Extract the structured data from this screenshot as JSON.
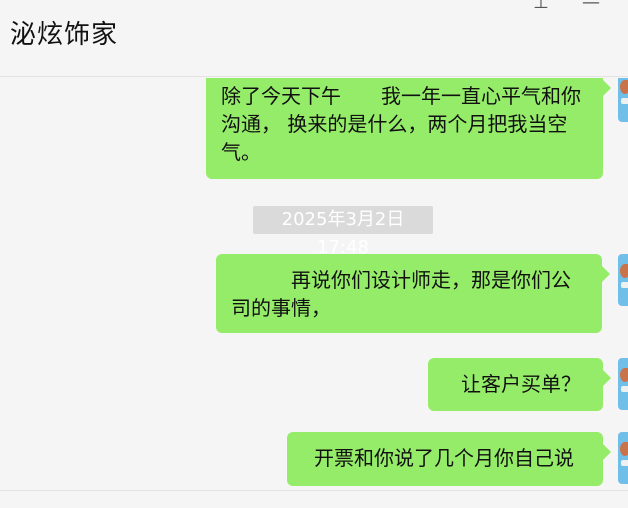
{
  "header": {
    "title": "泌炫饰家",
    "pin_glyph": "⊥",
    "minimize_glyph": "—"
  },
  "messages": [
    {
      "side": "right",
      "text": "除了今天下午　　我一年一直心平气和你沟通， 换来的是什么，两个月把我当空气。"
    },
    {
      "side": "right",
      "text": "再说你们设计师走，那是你们公司的事情，"
    },
    {
      "side": "right",
      "text": "让客户买单？"
    },
    {
      "side": "right",
      "text": "开票和你说了几个月你自己说"
    }
  ],
  "timestamp": "2025年3月2日 17:48",
  "colors": {
    "bubble": "#95ec69",
    "background": "#f5f5f5",
    "timestamp_bg": "#dadada"
  }
}
